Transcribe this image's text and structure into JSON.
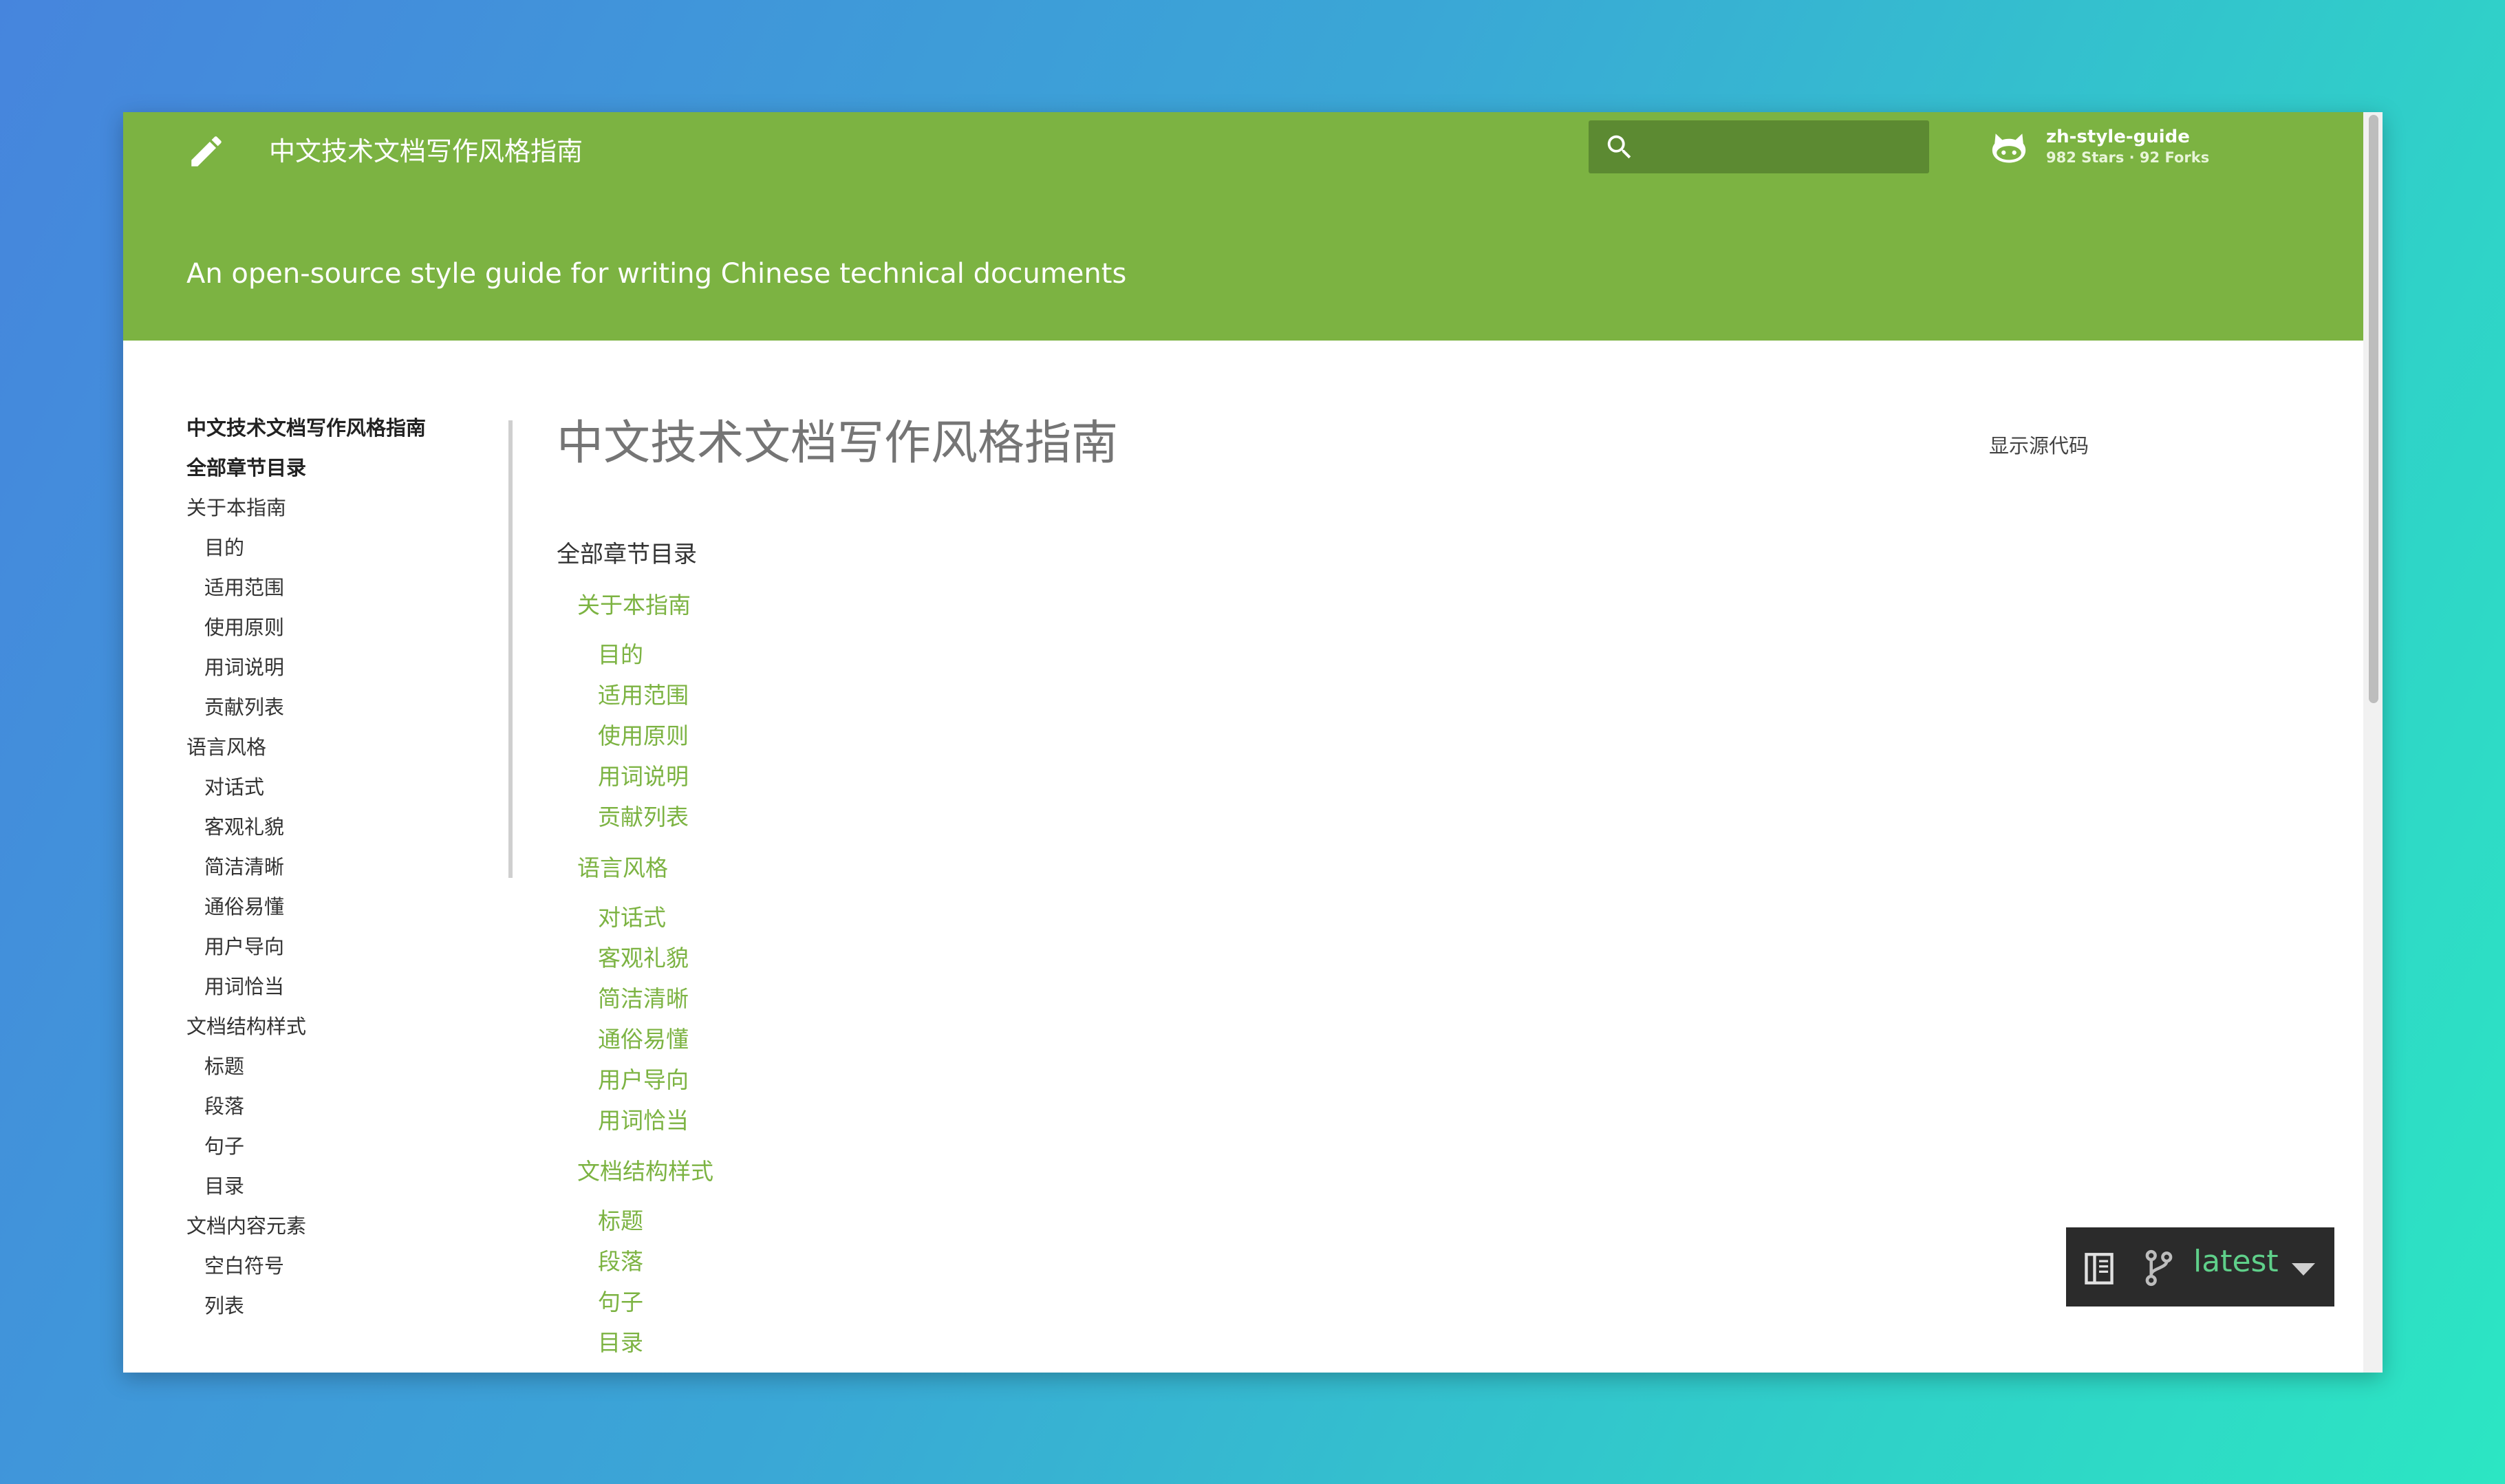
{
  "header": {
    "site_title": "中文技术文档写作风格指南",
    "tagline": "An open-source style guide for writing Chinese technical documents",
    "search": {
      "placeholder": "",
      "value": ""
    },
    "repo": {
      "name": "zh-style-guide",
      "stats": "982 Stars · 92 Forks"
    }
  },
  "sidebar": {
    "items": [
      {
        "label": "中文技术文档写作风格指南",
        "bold": true,
        "indent": false
      },
      {
        "label": "全部章节目录",
        "bold": true,
        "indent": false
      },
      {
        "label": "关于本指南",
        "bold": false,
        "indent": false
      },
      {
        "label": "目的",
        "bold": false,
        "indent": true
      },
      {
        "label": "适用范围",
        "bold": false,
        "indent": true
      },
      {
        "label": "使用原则",
        "bold": false,
        "indent": true
      },
      {
        "label": "用词说明",
        "bold": false,
        "indent": true
      },
      {
        "label": "贡献列表",
        "bold": false,
        "indent": true
      },
      {
        "label": "语言风格",
        "bold": false,
        "indent": false
      },
      {
        "label": "对话式",
        "bold": false,
        "indent": true
      },
      {
        "label": "客观礼貌",
        "bold": false,
        "indent": true
      },
      {
        "label": "简洁清晰",
        "bold": false,
        "indent": true
      },
      {
        "label": "通俗易懂",
        "bold": false,
        "indent": true
      },
      {
        "label": "用户导向",
        "bold": false,
        "indent": true
      },
      {
        "label": "用词恰当",
        "bold": false,
        "indent": true
      },
      {
        "label": "文档结构样式",
        "bold": false,
        "indent": false
      },
      {
        "label": "标题",
        "bold": false,
        "indent": true
      },
      {
        "label": "段落",
        "bold": false,
        "indent": true
      },
      {
        "label": "句子",
        "bold": false,
        "indent": true
      },
      {
        "label": "目录",
        "bold": false,
        "indent": true
      },
      {
        "label": "文档内容元素",
        "bold": false,
        "indent": false
      },
      {
        "label": "空白符号",
        "bold": false,
        "indent": true
      },
      {
        "label": "列表",
        "bold": false,
        "indent": true
      }
    ]
  },
  "main": {
    "page_title": "中文技术文档写作风格指南",
    "show_source": "显示源代码",
    "toc_heading": "全部章节目录",
    "toc": [
      {
        "label": "关于本指南",
        "level": 1
      },
      {
        "label": "目的",
        "level": 2
      },
      {
        "label": "适用范围",
        "level": 2
      },
      {
        "label": "使用原则",
        "level": 2
      },
      {
        "label": "用词说明",
        "level": 2
      },
      {
        "label": "贡献列表",
        "level": 2
      },
      {
        "label": "语言风格",
        "level": 1
      },
      {
        "label": "对话式",
        "level": 2
      },
      {
        "label": "客观礼貌",
        "level": 2
      },
      {
        "label": "简洁清晰",
        "level": 2
      },
      {
        "label": "通俗易懂",
        "level": 2
      },
      {
        "label": "用户导向",
        "level": 2
      },
      {
        "label": "用词恰当",
        "level": 2
      },
      {
        "label": "文档结构样式",
        "level": 1
      },
      {
        "label": "标题",
        "level": 2
      },
      {
        "label": "段落",
        "level": 2
      },
      {
        "label": "句子",
        "level": 2
      },
      {
        "label": "目录",
        "level": 2
      }
    ]
  },
  "version_panel": {
    "version": "latest"
  },
  "icons": {
    "header": [
      "pencil-icon",
      "search-icon",
      "github-icon"
    ],
    "version_panel": [
      "book-icon",
      "git-branch-icon",
      "caret-down-icon"
    ]
  },
  "colors": {
    "header_bg": "#7cb342",
    "search_bg": "#5c8a32",
    "link": "#7cb342",
    "version_panel_bg": "#2b2b2b",
    "version_text": "#5fd08a"
  }
}
